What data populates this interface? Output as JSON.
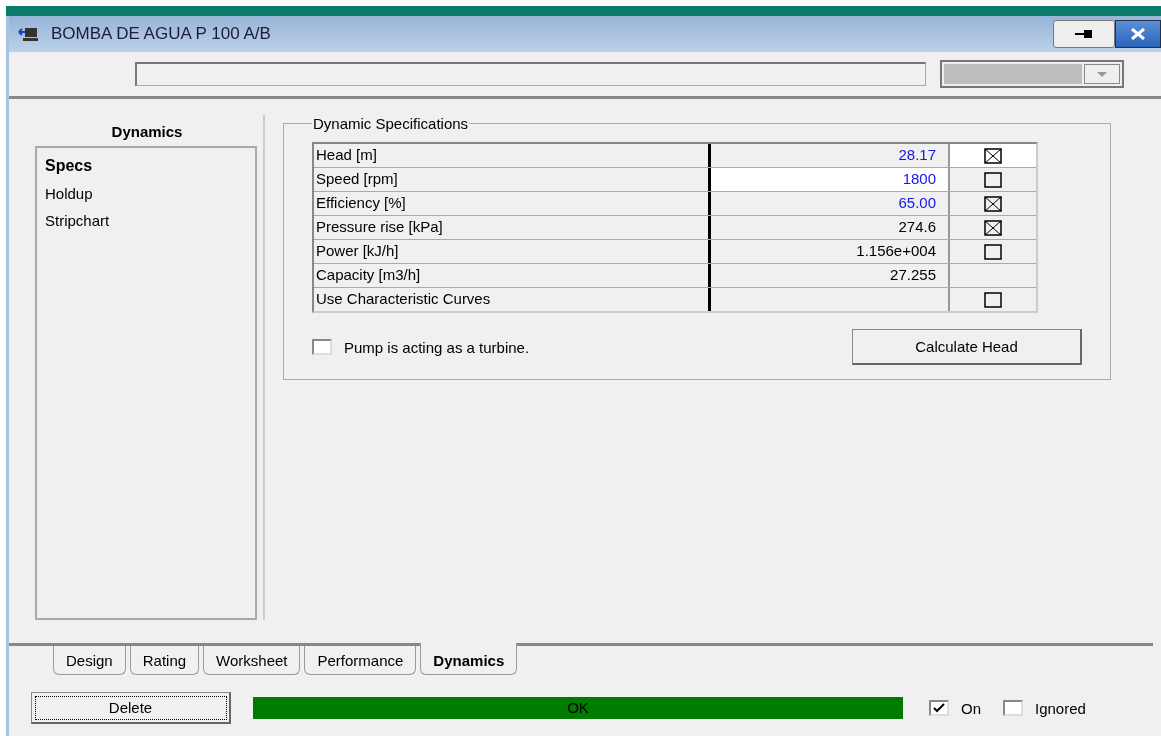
{
  "window": {
    "title": "BOMBA DE AGUA P 100 A/B"
  },
  "sidebar": {
    "heading": "Dynamics",
    "items": [
      {
        "label": "Specs",
        "selected": true
      },
      {
        "label": "Holdup",
        "selected": false
      },
      {
        "label": "Stripchart",
        "selected": false
      }
    ]
  },
  "group": {
    "title": "Dynamic Specifications",
    "rows": [
      {
        "label": "Head [m]",
        "value": "28.17",
        "user_entered": true,
        "selected": false,
        "checked": true
      },
      {
        "label": "Speed [rpm]",
        "value": "1800",
        "user_entered": true,
        "selected": true,
        "checked": false
      },
      {
        "label": "Efficiency [%]",
        "value": "65.00",
        "user_entered": true,
        "selected": false,
        "checked": true
      },
      {
        "label": "Pressure rise [kPa]",
        "value": "274.6",
        "user_entered": false,
        "selected": false,
        "checked": true
      },
      {
        "label": "Power [kJ/h]",
        "value": "1.156e+004",
        "user_entered": false,
        "selected": false,
        "checked": false
      },
      {
        "label": "Capacity [m3/h]",
        "value": "27.255",
        "user_entered": false,
        "selected": false
      },
      {
        "label": "Use Characteristic Curves",
        "selected": false,
        "checked": false
      }
    ],
    "turbine": {
      "label": "Pump is acting as a turbine.",
      "checked": false
    },
    "button": "Calculate Head"
  },
  "tabs": [
    {
      "label": "Design",
      "selected": false
    },
    {
      "label": "Rating",
      "selected": false
    },
    {
      "label": "Worksheet",
      "selected": false
    },
    {
      "label": "Performance",
      "selected": false
    },
    {
      "label": "Dynamics",
      "selected": true
    }
  ],
  "bottom": {
    "delete": "Delete",
    "status": "OK",
    "on": {
      "label": "On",
      "checked": true
    },
    "ignored": {
      "label": "Ignored",
      "checked": false
    }
  }
}
